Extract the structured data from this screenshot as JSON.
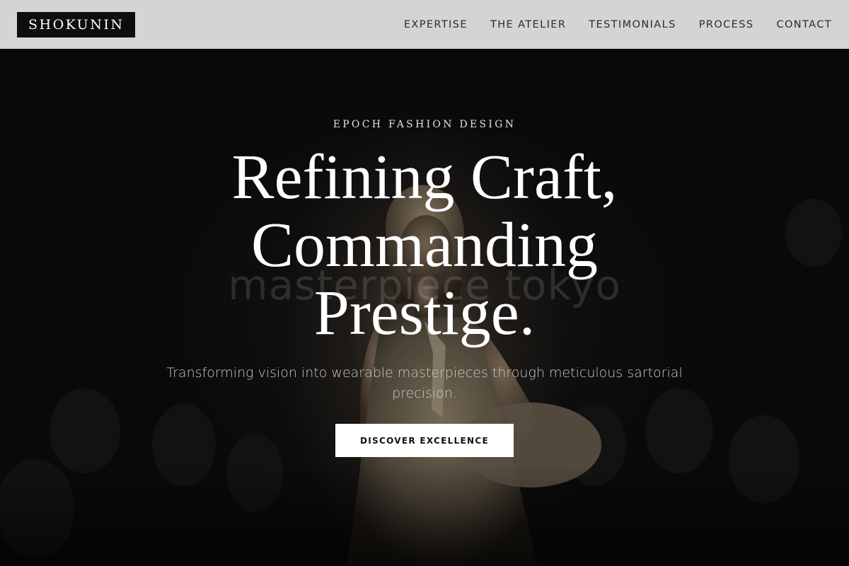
{
  "header": {
    "logo": "SHOKUNIN",
    "nav": [
      "EXPERTISE",
      "THE ATELIER",
      "TESTIMONIALS",
      "PROCESS",
      "CONTACT"
    ]
  },
  "hero": {
    "eyebrow": "EPOCH FASHION DESIGN",
    "headline": [
      "Refining Craft,",
      "Commanding",
      "Prestige."
    ],
    "background_text": "masterpiece tokyo",
    "subtitle": "Transforming vision into wearable masterpieces through meticulous sartorial precision.",
    "cta_label": "DISCOVER EXCELLENCE"
  },
  "colors": {
    "header_bg": "#d4d4d4",
    "logo_bg": "#0d0d0d",
    "hero_bg": "#0b0b0c",
    "cta_bg": "#ffffff"
  }
}
